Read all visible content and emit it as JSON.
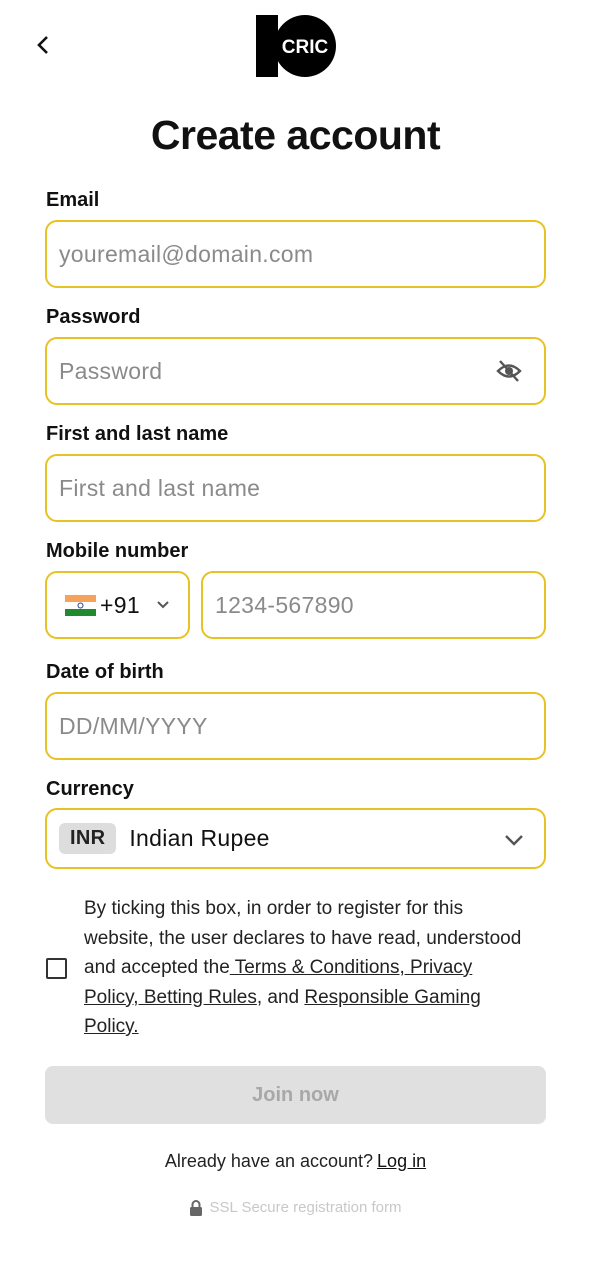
{
  "header": {
    "title": "Create account",
    "logo_text": "CRIC",
    "back_icon": "chevron-left-icon"
  },
  "form": {
    "email": {
      "label": "Email",
      "placeholder": "youremail@domain.com"
    },
    "password": {
      "label": "Password",
      "placeholder": "Password",
      "icon": "eye-off-icon"
    },
    "name": {
      "label": "First and last name",
      "placeholder": "First and last name"
    },
    "mobile": {
      "label": "Mobile number",
      "country_code": "+91",
      "placeholder": "1234-567890"
    },
    "dob": {
      "label": "Date of birth",
      "placeholder": "DD/MM/YYYY"
    },
    "currency": {
      "label": "Currency",
      "code": "INR",
      "name": "Indian Rupee"
    }
  },
  "terms": {
    "text": "By ticking this box, in order to register for this website, the user declares to have read, understood and accepted the",
    "link1": " Terms & Conditions, Privacy Policy, Betting Rules",
    "mid": ", and ",
    "link2": "Responsible Gaming Policy.",
    "checked": false
  },
  "join_label": "Join now",
  "login": {
    "prompt": "Already have an account?",
    "link": "Log in"
  },
  "ssl": "SSL Secure registration form",
  "colors": {
    "field_border": "#e6c224",
    "button_disabled": "#e0e0e0"
  }
}
